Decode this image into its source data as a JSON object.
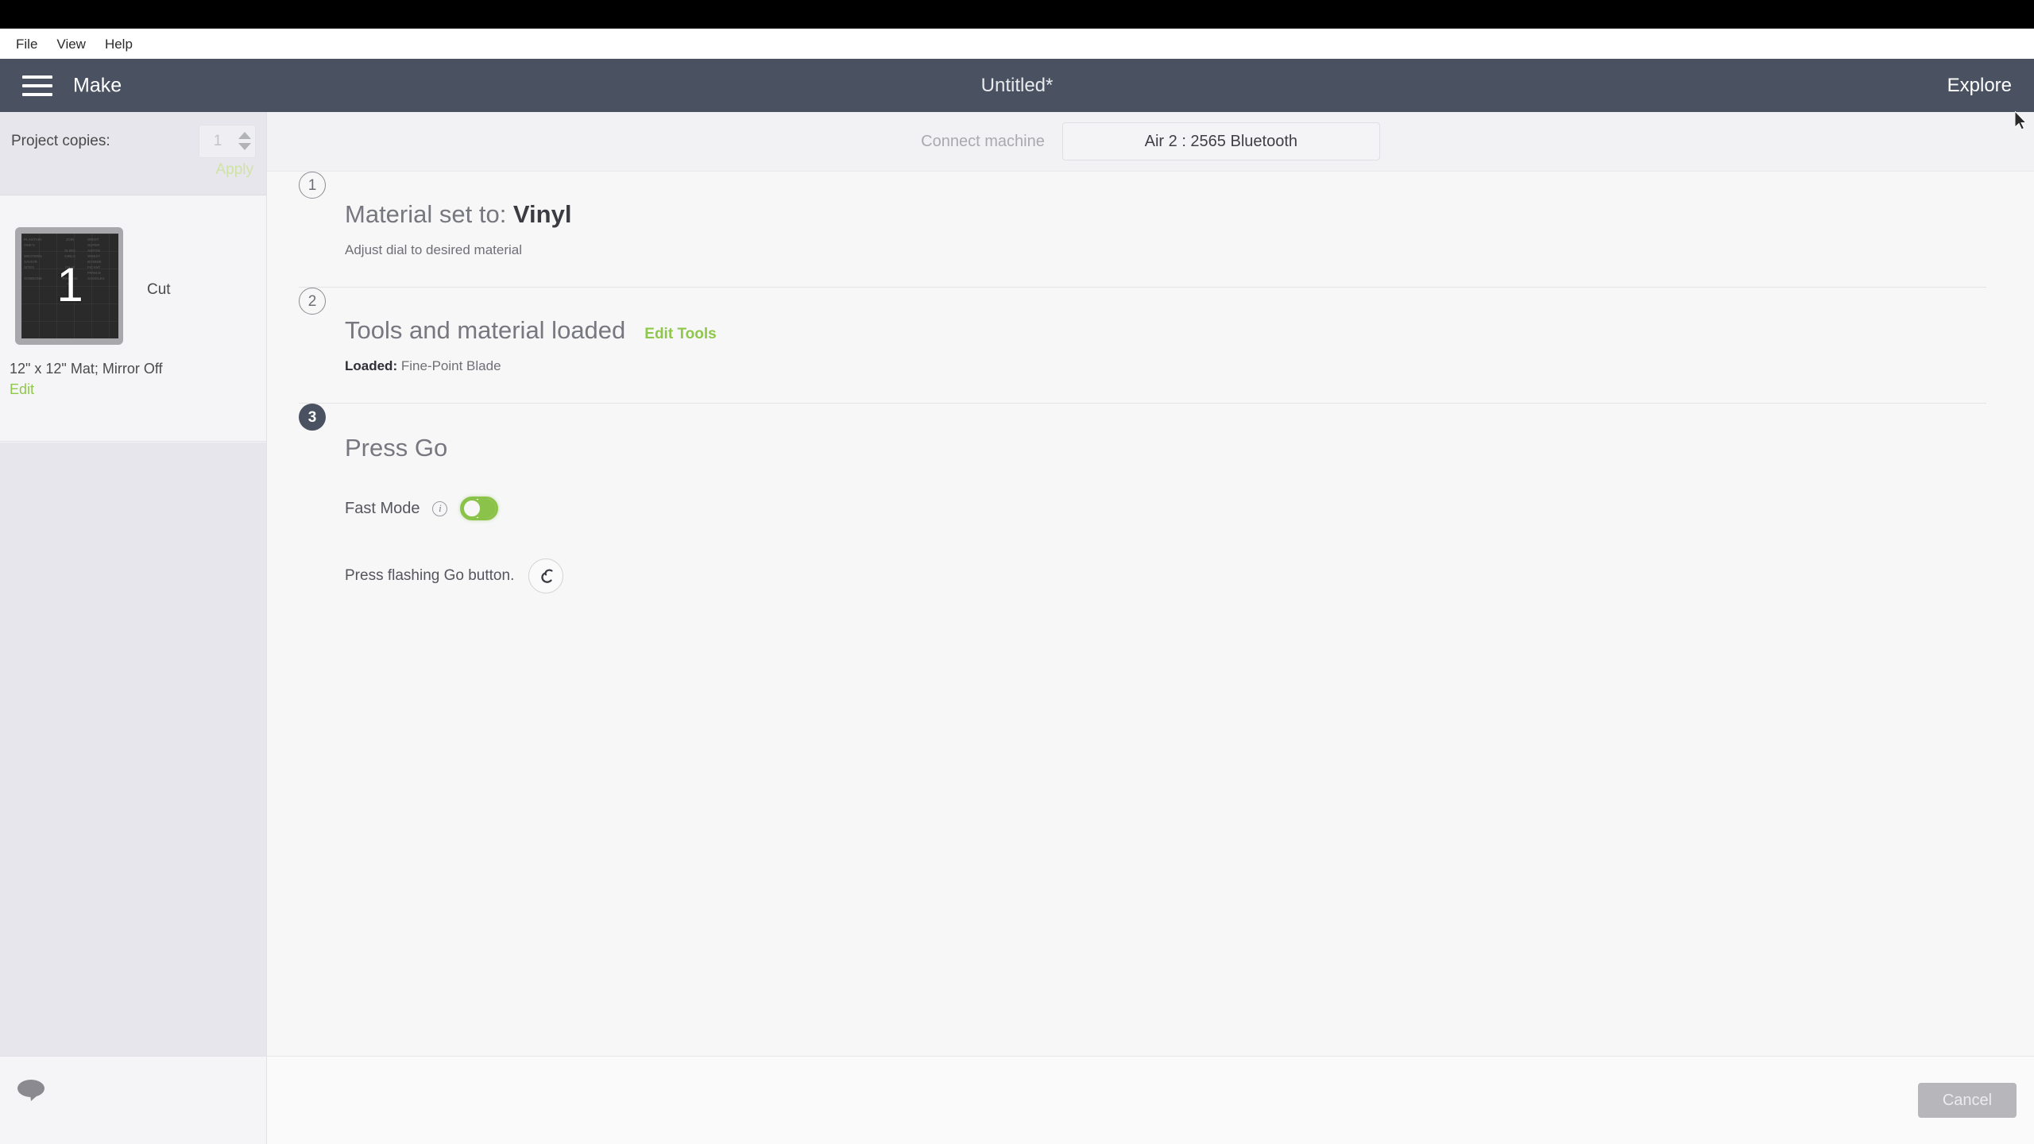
{
  "menubar": {
    "items": [
      "File",
      "View",
      "Help"
    ]
  },
  "header": {
    "menu_icon": "hamburger-menu-icon",
    "app_label": "Make",
    "document_title": "Untitled*",
    "explore_label": "Explore"
  },
  "sidebar": {
    "copies": {
      "label": "Project copies:",
      "value": "1",
      "apply_label": "Apply",
      "increment_icon": "chevron-up-icon",
      "decrement_icon": "chevron-down-icon"
    },
    "mat": {
      "number": "1",
      "operation": "Cut",
      "meta": "12\" x 12\" Mat; Mirror Off",
      "edit_label": "Edit",
      "preview_columns": [
        [
          "PLANTAIN",
          "ONE'S",
          "",
          "WESTERN",
          "SAVIOR",
          "SITES",
          "",
          "SOMEONE"
        ],
        [
          "JOIN",
          "",
          "SLING",
          "GIRLS",
          "",
          "OR IS",
          "",
          "Premium",
          "Cut"
        ],
        [
          "WRIST",
          "SUPER",
          "ANTON",
          "WHEAT",
          "BONNIE",
          "FICANT",
          "PRINCE",
          "SADDLES"
        ]
      ]
    },
    "chat_icon": "chat-bubble-icon"
  },
  "main": {
    "connect": {
      "label": "Connect machine",
      "machine_name": "Air 2 : 2565 Bluetooth"
    },
    "steps": [
      {
        "number": "1",
        "title_prefix": "Material set to: ",
        "title_value": "Vinyl",
        "subtitle": "Adjust dial to desired material"
      },
      {
        "number": "2",
        "title": "Tools and material loaded",
        "action": "Edit Tools",
        "sub_label": "Loaded:",
        "sub_value": "Fine-Point Blade"
      },
      {
        "number": "3",
        "title": "Press Go",
        "fast_mode_label": "Fast Mode",
        "fast_mode_state": "on",
        "info_icon": "info-icon",
        "press_go_label": "Press flashing Go button.",
        "go_button_icon": "cricut-logo-icon"
      }
    ]
  },
  "footer": {
    "cancel_label": "Cancel"
  },
  "colors": {
    "header_bg": "#4a5160",
    "accent_green": "#8fc74a",
    "toggle_green": "#8bc34a",
    "text_muted": "#77777f",
    "disabled_gray": "#b6b6bb"
  }
}
